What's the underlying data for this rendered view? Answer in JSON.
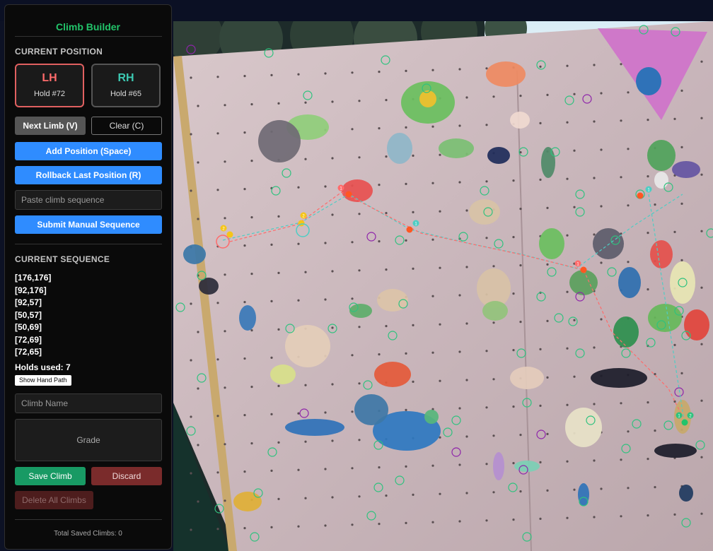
{
  "panel": {
    "title": "Climb Builder",
    "current_position_heading": "CURRENT POSITION",
    "limbs": [
      {
        "label": "LH",
        "hold": "Hold #72",
        "selected": true
      },
      {
        "label": "RH",
        "hold": "Hold #65",
        "selected": false
      }
    ],
    "buttons": {
      "next_limb": "Next Limb (V)",
      "clear": "Clear (C)",
      "add_position": "Add Position (Space)",
      "rollback": "Rollback Last Position (R)",
      "submit_manual": "Submit Manual Sequence"
    },
    "manual_sequence_placeholder": "Paste climb sequence",
    "current_sequence_heading": "CURRENT SEQUENCE",
    "sequence": [
      "[176,176]",
      "[92,176]",
      "[92,57]",
      "[50,57]",
      "[50,69]",
      "[72,69]",
      "[72,65]"
    ],
    "holds_used": "Holds used: 7",
    "show_hand_path": "Show Hand Path",
    "climb_name_placeholder": "Climb Name",
    "grade_placeholder": "Grade",
    "save": "Save Climb",
    "discard": "Discard",
    "delete_all": "Delete All Climbs",
    "total_saved": "Total Saved Climbs: 0"
  },
  "wall": {
    "colors": {
      "panel_bg": "#0a0a0a",
      "accent_green": "#22c46a",
      "accent_blue": "#2f8cff",
      "left_hand_path": "#ff6b6b",
      "right_hand_path": "#4ecdc4",
      "hold_outline": "#2ec27e",
      "hold_outline_alt": "#8e24aa",
      "selected_hold": "#ff5722"
    },
    "path_markers": [
      {
        "label": "1",
        "color": "#ff6b6b"
      },
      {
        "label": "1",
        "color": "#4ecdc4"
      },
      {
        "label": "2",
        "color": "#f5c518"
      },
      {
        "label": "2",
        "color": "#f5c518"
      },
      {
        "label": "1",
        "color": "#4ecdc4"
      },
      {
        "label": "1",
        "color": "#ff6b6b"
      },
      {
        "label": "1",
        "color": "#2ec27e"
      },
      {
        "label": "2",
        "color": "#2ec27e"
      }
    ]
  }
}
